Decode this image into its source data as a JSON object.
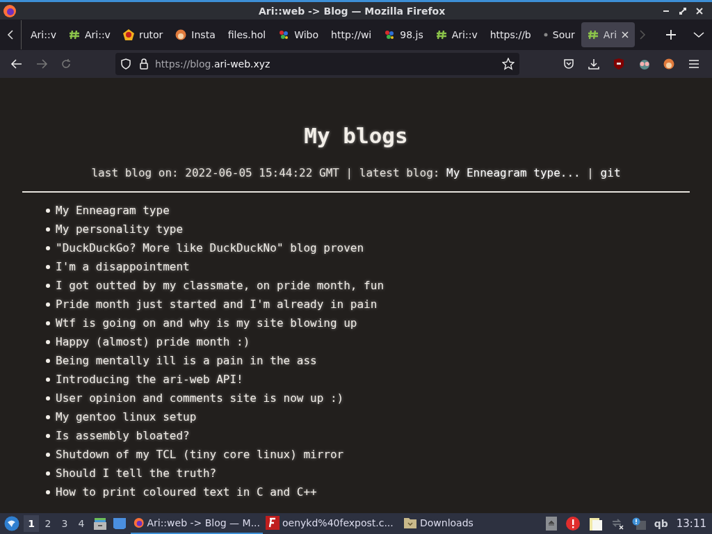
{
  "window": {
    "title": "Ari::web -> Blog — Mozilla Firefox"
  },
  "tabs": [
    {
      "label": "Ari::v",
      "kind": "plain",
      "selected": false
    },
    {
      "label": "Ari::v",
      "kind": "hash",
      "selected": false
    },
    {
      "label": "rutor",
      "kind": "badge",
      "selected": false
    },
    {
      "label": "Insta",
      "kind": "face",
      "selected": false
    },
    {
      "label": "files.hol",
      "kind": "plain",
      "selected": false
    },
    {
      "label": "Wibo",
      "kind": "splash",
      "selected": false
    },
    {
      "label": "http://wi",
      "kind": "plain",
      "selected": false
    },
    {
      "label": "98.js",
      "kind": "splash",
      "selected": false
    },
    {
      "label": "Ari::v",
      "kind": "hash",
      "selected": false
    },
    {
      "label": "https://b",
      "kind": "plain",
      "selected": false
    },
    {
      "label": "Sour",
      "kind": "dot",
      "selected": false
    },
    {
      "label": "Ari",
      "kind": "hash",
      "selected": true
    }
  ],
  "address_bar": {
    "prefix": "https://blog.",
    "domain": "ari-web.xyz"
  },
  "page": {
    "heading": "My blogs",
    "meta": [
      {
        "kind": "text",
        "text": "last blog on: 2022-06-05 15:44:22 GMT | latest blog:"
      },
      {
        "kind": "link",
        "text": "My Enneagram type..."
      },
      {
        "kind": "text",
        "text": "|"
      },
      {
        "kind": "link",
        "text": "git"
      }
    ],
    "posts": [
      "My Enneagram type",
      "My personality type",
      "\"DuckDuckGo? More like DuckDuckNo\" blog proven",
      "I'm a disappointment",
      "I got outted by my classmate, on pride month, fun",
      "Pride month just started and I'm already in pain",
      "Wtf is going on and why is my site blowing up",
      "Happy (almost) pride month :)",
      "Being mentally ill is a pain in the ass",
      "Introducing the ari-web API!",
      "User opinion and comments site is now up :)",
      "My gentoo linux setup",
      "Is assembly bloated?",
      "Shutdown of my TCL (tiny core linux) mirror",
      "Should I tell the truth?",
      "How to print coloured text in C and C++"
    ]
  },
  "taskbar": {
    "workspaces": [
      {
        "label": "1",
        "selected": true
      },
      {
        "label": "2",
        "selected": false
      },
      {
        "label": "3",
        "selected": false
      },
      {
        "label": "4",
        "selected": false
      }
    ],
    "windows": [
      {
        "label": "Ari::web -> Blog — M...",
        "kind": "firefox",
        "selected": true
      },
      {
        "label": "oenykd%40fexpost.c...",
        "kind": "filezilla",
        "selected": false
      },
      {
        "label": "Downloads",
        "kind": "folder",
        "selected": false
      }
    ],
    "tray_text": "qb",
    "clock": "13:11"
  }
}
